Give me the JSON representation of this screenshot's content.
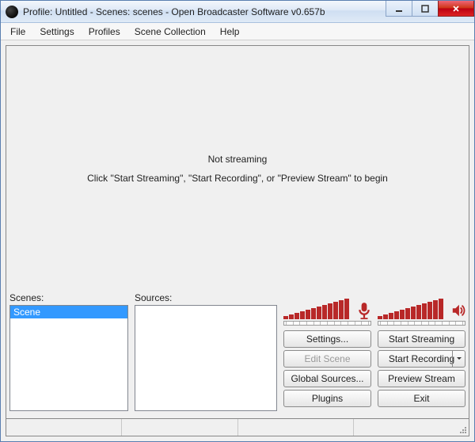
{
  "window": {
    "title": "Profile: Untitled - Scenes: scenes - Open Broadcaster Software v0.657b"
  },
  "menu": {
    "items": [
      "File",
      "Settings",
      "Profiles",
      "Scene Collection",
      "Help"
    ]
  },
  "preview": {
    "status_line": "Not streaming",
    "hint_line": "Click \"Start Streaming\", \"Start Recording\", or \"Preview Stream\" to begin"
  },
  "panels": {
    "scenes_label": "Scenes:",
    "sources_label": "Sources:",
    "scenes": [
      {
        "name": "Scene",
        "selected": true
      }
    ],
    "sources": []
  },
  "buttons": {
    "settings": "Settings...",
    "edit_scene": "Edit Scene",
    "global_sources": "Global Sources...",
    "plugins": "Plugins",
    "start_streaming": "Start Streaming",
    "start_recording": "Start Recording",
    "preview_stream": "Preview Stream",
    "exit": "Exit"
  },
  "colors": {
    "meter": "#b82828",
    "selection": "#3399ff"
  }
}
